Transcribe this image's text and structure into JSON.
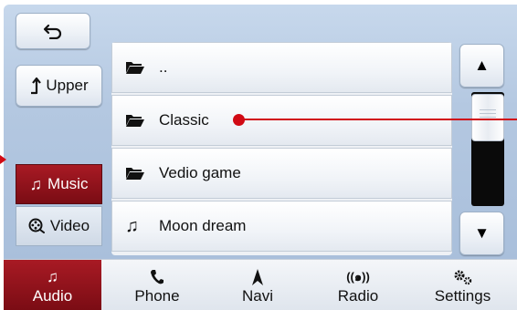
{
  "nav": {
    "back_icon": "back-arrow-icon",
    "upper_label": "Upper",
    "upper_icon": "up-arrow-icon"
  },
  "source_tabs": [
    {
      "label": "Music",
      "icon": "music-note-icon",
      "active": true
    },
    {
      "label": "Video",
      "icon": "film-reel-icon",
      "active": false
    }
  ],
  "file_list": [
    {
      "label": "..",
      "icon": "folder-icon"
    },
    {
      "label": "Classic",
      "icon": "folder-icon"
    },
    {
      "label": "Vedio game",
      "icon": "folder-icon"
    },
    {
      "label": "Moon dream",
      "icon": "music-note-icon"
    }
  ],
  "scroll": {
    "up_icon": "triangle-up-icon",
    "down_icon": "triangle-down-icon"
  },
  "bottom_tabs": [
    {
      "label": "Audio",
      "icon": "music-note-icon",
      "active": true
    },
    {
      "label": "Phone",
      "icon": "phone-icon",
      "active": false
    },
    {
      "label": "Navi",
      "icon": "navigation-arrow-icon",
      "active": false
    },
    {
      "label": "Radio",
      "icon": "radio-antenna-icon",
      "active": false
    },
    {
      "label": "Settings",
      "icon": "gears-icon",
      "active": false
    }
  ],
  "colors": {
    "accent_red": "#a81a24",
    "callout_red": "#d10a14",
    "panel_blue": "#b4c8e1"
  }
}
